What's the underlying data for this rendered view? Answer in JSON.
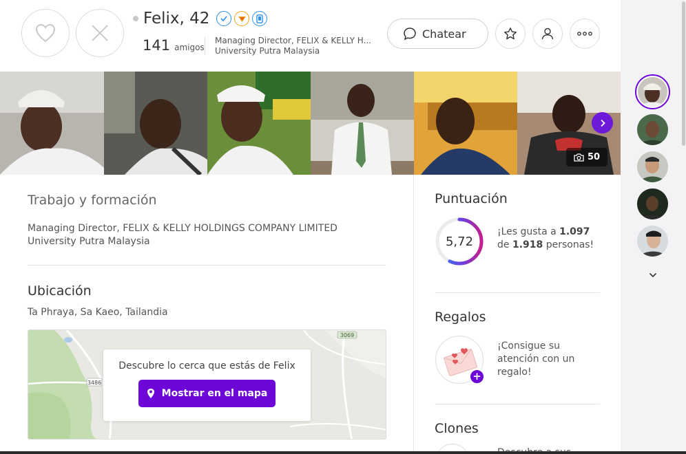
{
  "profile": {
    "name_age": "Felix, 42",
    "friends_count": "141",
    "friends_label": "amigos",
    "job_short": "Managing Director, FELIX & KELLY H...",
    "school_short": "University Putra Malaysia",
    "badges": [
      "verified-check-icon",
      "superhero-badge-icon",
      "phone-verified-icon"
    ]
  },
  "actions": {
    "like_icon": "heart-icon",
    "dislike_icon": "close-icon",
    "chat_label": "Chatear",
    "favorite_icon": "star-icon",
    "profile_icon": "user-icon",
    "more_icon": "more-dots-icon"
  },
  "photos": {
    "count": "50",
    "next_icon": "chevron-right-icon"
  },
  "work": {
    "heading": "Trabajo y formación",
    "job": "Managing Director, FELIX & KELLY HOLDINGS COMPANY LIMITED",
    "school": "University Putra Malaysia"
  },
  "location": {
    "heading": "Ubicación",
    "place": "Ta Phraya, Sa Kaeo, Tailandia",
    "map_prompt": "Descubre lo cerca que estás de Felix",
    "map_button": "Mostrar en el mapa",
    "road_labels": [
      "3069",
      "3486"
    ]
  },
  "score": {
    "heading": "Puntuación",
    "value": "5,72",
    "value_fraction": 0.572,
    "text_pre": "¡Les gusta a ",
    "likes": "1.097",
    "text_mid": "de ",
    "total": "1.918",
    "text_post": " personas!"
  },
  "gifts": {
    "heading": "Regalos",
    "text_line1": "¡Consigue su",
    "text_line2": "atención con un",
    "text_line3": "regalo!"
  },
  "clones": {
    "heading": "Clones",
    "text_peek": "Descubre a sus"
  },
  "colors": {
    "accent": "#6c07d8",
    "ring_start": "#2b8cf0",
    "ring_end": "#c41f8e"
  }
}
